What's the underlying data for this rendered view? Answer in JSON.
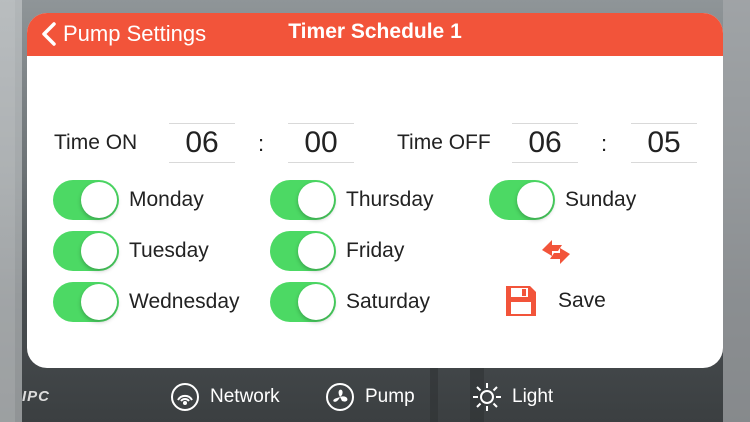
{
  "header": {
    "back_label": "Pump Settings",
    "title": "Timer Schedule 1"
  },
  "timer": {
    "on_label": "Time ON",
    "on_hour": "06",
    "on_minute": "00",
    "off_label": "Time OFF",
    "off_hour": "06",
    "off_minute": "05",
    "separator": ":"
  },
  "days": [
    {
      "label": "Monday",
      "enabled": true
    },
    {
      "label": "Tuesday",
      "enabled": true
    },
    {
      "label": "Wednesday",
      "enabled": true
    },
    {
      "label": "Thursday",
      "enabled": true
    },
    {
      "label": "Friday",
      "enabled": true
    },
    {
      "label": "Saturday",
      "enabled": true
    },
    {
      "label": "Sunday",
      "enabled": true
    }
  ],
  "actions": {
    "save_label": "Save",
    "refresh_icon": "refresh-arrows-icon",
    "save_icon": "floppy-disk-icon"
  },
  "bottom_nav": {
    "logo": "IPC",
    "items": [
      {
        "label": "Network",
        "icon": "wifi-signal-icon"
      },
      {
        "label": "Pump",
        "icon": "fan-icon"
      },
      {
        "label": "Light",
        "icon": "sun-icon"
      }
    ]
  },
  "colors": {
    "accent": "#f2543a",
    "toggle_on": "#4cd964",
    "card": "#ffffff"
  }
}
